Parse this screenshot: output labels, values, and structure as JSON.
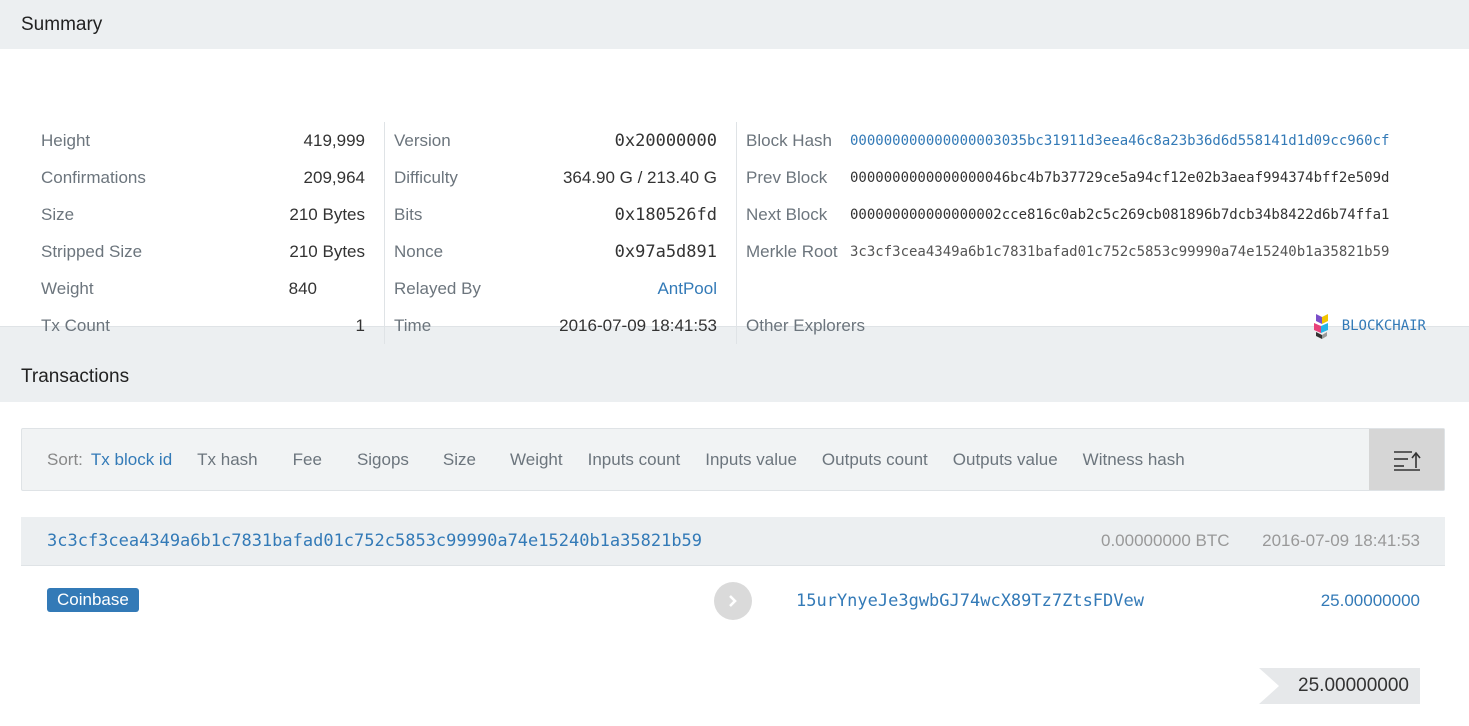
{
  "summary": {
    "title": "Summary",
    "col1": [
      {
        "label": "Height",
        "value": "419,999"
      },
      {
        "label": "Confirmations",
        "value": "209,964"
      },
      {
        "label": "Size",
        "value": "210 Bytes"
      },
      {
        "label": "Stripped Size",
        "value": "210 Bytes"
      },
      {
        "label": "Weight",
        "value": "840"
      },
      {
        "label": "Tx Count",
        "value": "1"
      }
    ],
    "col2": [
      {
        "label": "Version",
        "value": "0x20000000"
      },
      {
        "label": "Difficulty",
        "value": "364.90 G / 213.40 G"
      },
      {
        "label": "Bits",
        "value": "0x180526fd"
      },
      {
        "label": "Nonce",
        "value": "0x97a5d891"
      },
      {
        "label": "Relayed By",
        "value": "AntPool"
      },
      {
        "label": "Time",
        "value": "2016-07-09 18:41:53"
      }
    ],
    "col3": {
      "block_hash_label": "Block Hash",
      "block_hash": "000000000000000003035bc31911d3eea46c8a23b36d6d558141d1d09cc960cf",
      "prev_block_label": "Prev Block",
      "prev_block": "0000000000000000046bc4b7b37729ce5a94cf12e02b3aeaf994374bff2e509d",
      "next_block_label": "Next Block",
      "next_block": "000000000000000002cce816c0ab2c5c269cb081896b7dcb34b8422d6b74ffa1",
      "merkle_root_label": "Merkle Root",
      "merkle_root": "3c3cf3cea4349a6b1c7831bafad01c752c5853c99990a74e15240b1a35821b59",
      "other_explorers_label": "Other Explorers",
      "explorer_name": "BLOCKCHAIR"
    }
  },
  "transactions": {
    "title": "Transactions",
    "sort_label": "Sort:",
    "sort_options": [
      "Tx block id",
      "Tx hash",
      "Fee",
      "Sigops",
      "Size",
      "Weight",
      "Inputs count",
      "Inputs value",
      "Outputs count",
      "Outputs value",
      "Witness hash"
    ],
    "active_sort": "Tx block id",
    "sort_button_icon": "sort-ascending-icon",
    "items": [
      {
        "hash": "3c3cf3cea4349a6b1c7831bafad01c752c5853c99990a74e15240b1a35821b59",
        "fee": "0.00000000 BTC",
        "time": "2016-07-09 18:41:53",
        "input_label": "Coinbase",
        "output_address": "15urYnyeJe3gwbGJ74wcX89Tz7ZtsFDVew",
        "output_value": "25.00000000",
        "total": "25.00000000"
      }
    ]
  },
  "colors": {
    "link": "#337ab7",
    "header_bg": "#eceff1",
    "badge": "#337ab7"
  }
}
